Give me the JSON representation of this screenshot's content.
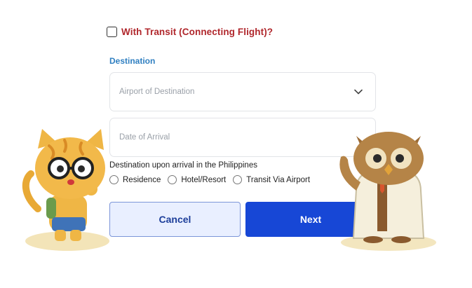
{
  "transit": {
    "label": "With Transit (Connecting Flight)?",
    "checked": false
  },
  "destination": {
    "section_label": "Destination",
    "airport_placeholder": "Airport of Destination",
    "date_placeholder": "Date of Arrival"
  },
  "arrival": {
    "question": "Destination upon arrival in the Philippines",
    "options": [
      "Residence",
      "Hotel/Resort",
      "Transit Via Airport"
    ]
  },
  "buttons": {
    "cancel": "Cancel",
    "next": "Next"
  },
  "colors": {
    "transit_label": "#b0272c",
    "section_label": "#2f7fc1",
    "primary_button": "#1747d6",
    "secondary_button_bg": "#e9efff"
  },
  "icons": [
    "chevron-down-icon",
    "cat-mascot",
    "owl-mascot"
  ]
}
